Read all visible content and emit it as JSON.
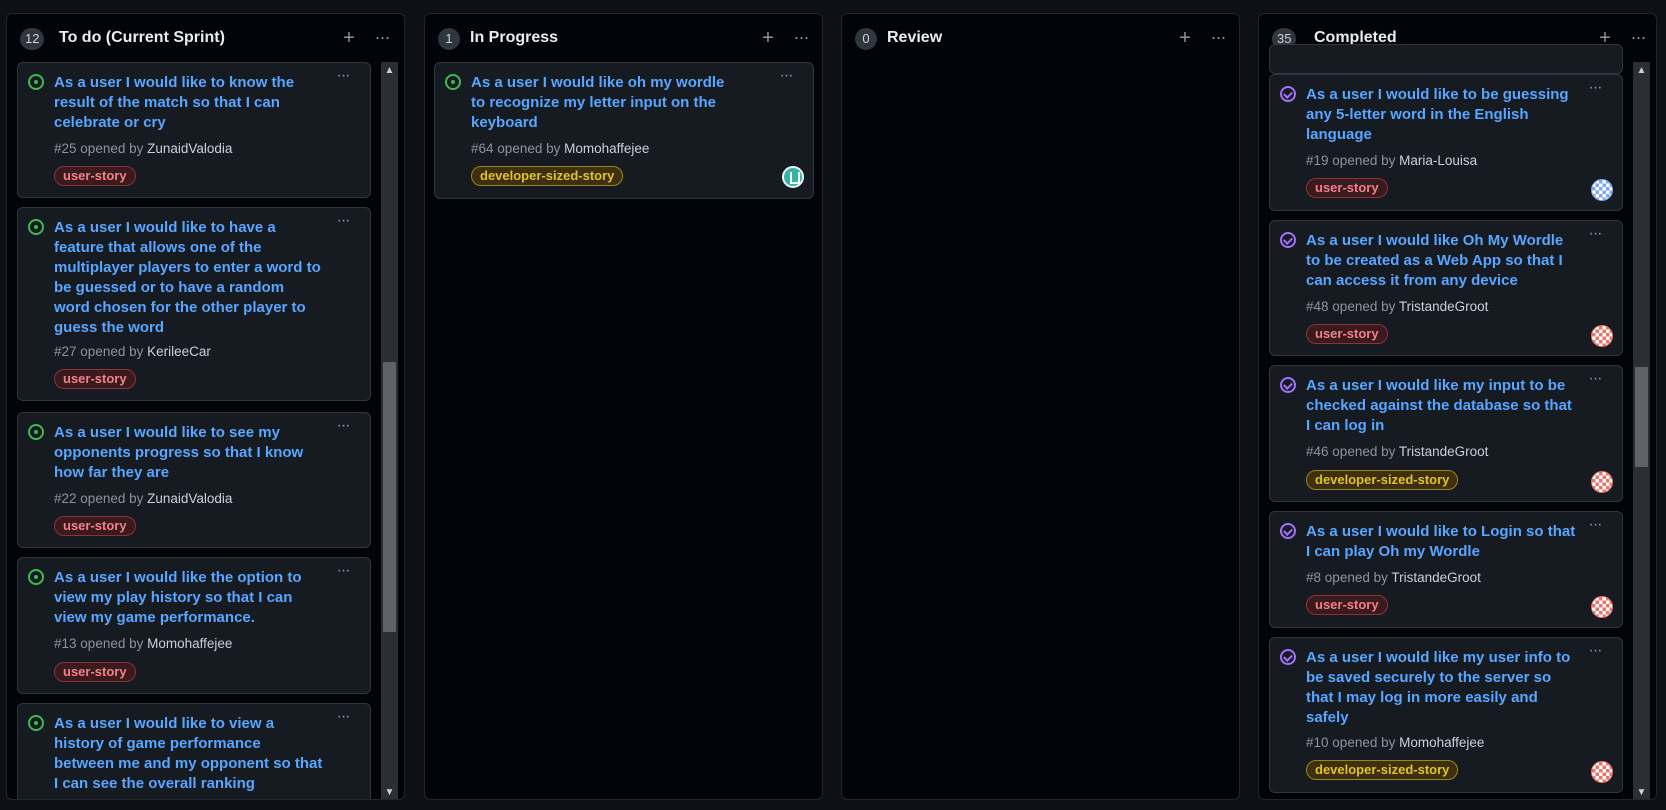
{
  "columns": [
    {
      "count": "12",
      "title": "To do (Current Sprint)",
      "cards": [
        {
          "title": "As a user I would like to know the result of the match so that I can celebrate or cry",
          "number": "#25",
          "opened_by": "opened by",
          "author": "ZunaidValodia",
          "label": "user-story"
        },
        {
          "title": "As a user I would like to have a feature that allows one of the multiplayer players to enter a word to be guessed or to have a random word chosen for the other player to guess the word",
          "number": "#27",
          "opened_by": "opened by",
          "author": "KerileeCar",
          "label": "user-story"
        },
        {
          "title": "As a user I would like to see my opponents progress so that I know how far they are",
          "number": "#22",
          "opened_by": "opened by",
          "author": "ZunaidValodia",
          "label": "user-story"
        },
        {
          "title": "As a user I would like the option to view my play history so that I can view my game performance.",
          "number": "#13",
          "opened_by": "opened by",
          "author": "Momohaffejee",
          "label": "user-story"
        },
        {
          "title": "As a user I would like to view a history of game performance between me and my opponent so that I can see the overall ranking"
        }
      ]
    },
    {
      "count": "1",
      "title": "In Progress",
      "cards": [
        {
          "title": "As a user I would like oh my wordle to recognize my letter input on the keyboard",
          "number": "#64",
          "opened_by": "opened by",
          "author": "Momohaffejee",
          "label": "developer-sized-story",
          "avatar": "teal-identicon"
        }
      ]
    },
    {
      "count": "0",
      "title": "Review",
      "cards": []
    },
    {
      "count": "35",
      "title": "Completed",
      "cards": [
        {
          "title": "As a user I would like to be guessing any 5-letter word in the English language",
          "number": "#19",
          "opened_by": "opened by",
          "author": "Maria-Louisa",
          "label": "user-story",
          "avatar": "blue-identicon"
        },
        {
          "title": "As a user I would like Oh My Wordle to be created as a Web App so that I can access it from any device",
          "number": "#48",
          "opened_by": "opened by",
          "author": "TristandeGroot",
          "label": "user-story",
          "avatar": "red-identicon"
        },
        {
          "title": "As a user I would like my input to be checked against the database so that I can log in",
          "number": "#46",
          "opened_by": "opened by",
          "author": "TristandeGroot",
          "label": "developer-sized-story",
          "avatar": "red-identicon"
        },
        {
          "title": "As a user I would like to Login so that I can play Oh my Wordle",
          "number": "#8",
          "opened_by": "opened by",
          "author": "TristandeGroot",
          "label": "user-story",
          "avatar": "red-identicon"
        },
        {
          "title": "As a user I would like my user info to be saved securely to the server so that I may log in more easily and safely",
          "number": "#10",
          "opened_by": "opened by",
          "author": "Momohaffejee",
          "label": "developer-sized-story",
          "avatar": "red-identicon"
        }
      ]
    }
  ],
  "icons": {
    "add": "plus-icon",
    "more": "kebab-horizontal-icon",
    "open_issue": "issue-opened-icon",
    "closed_issue": "issue-closed-icon",
    "scroll_up": "scroll-up-arrow",
    "scroll_down": "scroll-down-arrow"
  },
  "glyphs": {
    "add": "+",
    "more": "···",
    "scroll_up": "▲",
    "scroll_down": "▼"
  },
  "colors": {
    "background": "#0d1117",
    "column": "#010409",
    "card": "#161b22",
    "link": "#58a6ff",
    "open_icon": "#3fb950",
    "closed_icon": "#a371f7",
    "user_story_label": "#f0808b",
    "dev_story_label": "#e3c228"
  }
}
